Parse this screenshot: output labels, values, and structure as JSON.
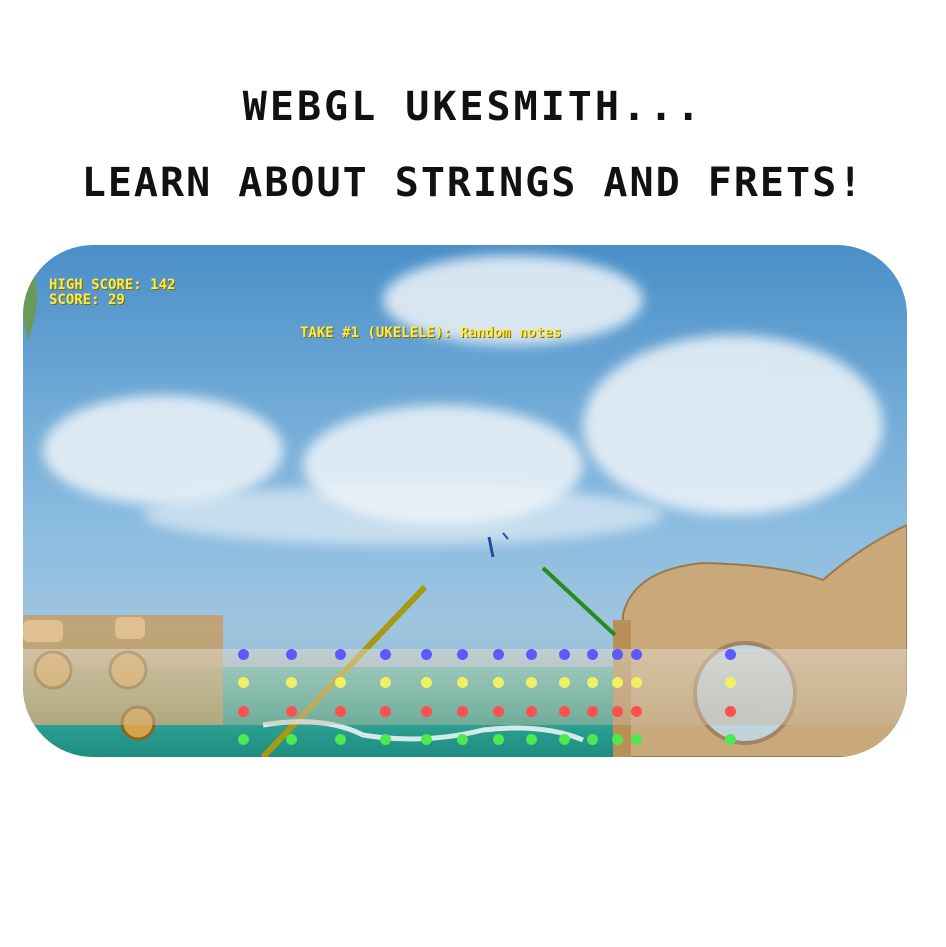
{
  "header": {
    "line1": "WEBGL UKESMITH...",
    "line2": "LEARN ABOUT STRINGS AND FRETS!"
  },
  "hud": {
    "high_score_label": "HIGH SCORE: 142",
    "score_label": "SCORE: 29",
    "take_label": "TAKE #1 (UKELELE): Random notes"
  },
  "strings": [
    {
      "name": "string-1",
      "color": "#5a5aff"
    },
    {
      "name": "string-2",
      "color": "#f0f060"
    },
    {
      "name": "string-3",
      "color": "#ff5050"
    },
    {
      "name": "string-4",
      "color": "#50e850"
    }
  ],
  "fret_count": 12
}
